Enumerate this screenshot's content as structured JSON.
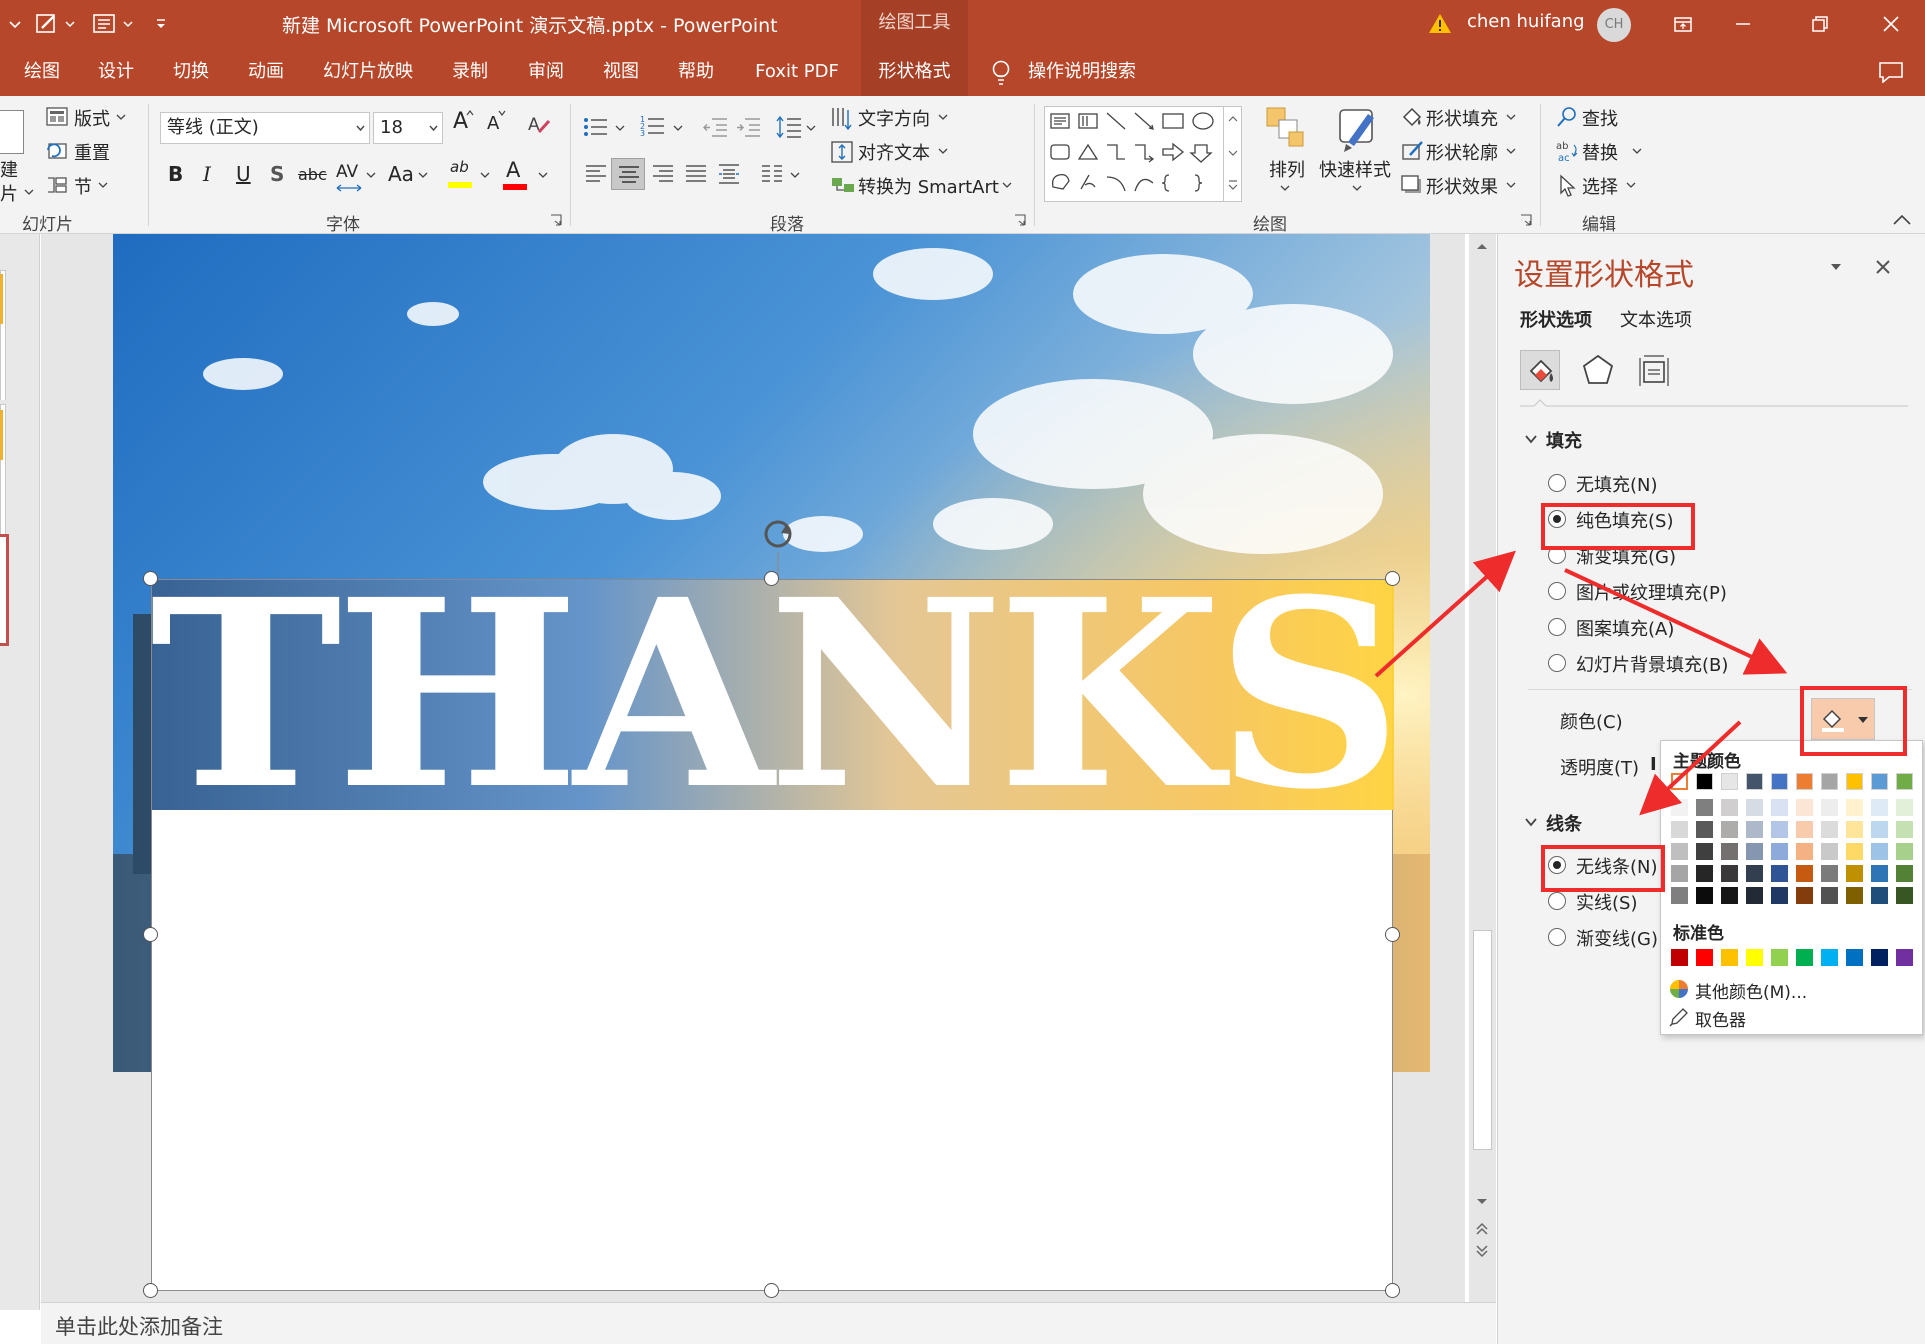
{
  "titlebar": {
    "title": "新建 Microsoft PowerPoint 演示文稿.pptx  -  PowerPoint",
    "context_tab": "绘图工具",
    "user": "chen huifang",
    "avatar_initials": "CH"
  },
  "tabs": [
    {
      "label": "绘图"
    },
    {
      "label": "设计"
    },
    {
      "label": "切换"
    },
    {
      "label": "动画"
    },
    {
      "label": "幻灯片放映"
    },
    {
      "label": "录制"
    },
    {
      "label": "审阅"
    },
    {
      "label": "视图"
    },
    {
      "label": "帮助"
    },
    {
      "label": "Foxit PDF"
    },
    {
      "label": "形状格式"
    }
  ],
  "tell_me": "操作说明搜索",
  "ribbon": {
    "slides": {
      "new_slide_partial_1": "建",
      "new_slide_partial_2": "片",
      "layout": "版式",
      "reset": "重置",
      "section": "节",
      "group_label": "幻灯片"
    },
    "font": {
      "font_name": "等线 (正文)",
      "font_size": "18",
      "grow": "A",
      "shrink": "A",
      "bold": "B",
      "italic": "I",
      "underline": "U",
      "shadow": "S",
      "strike": "abc",
      "spacing": "AV",
      "case": "Aa",
      "highlight": "ab",
      "font_color": "A",
      "group_label": "字体"
    },
    "paragraph": {
      "text_direction": "文字方向",
      "align_text": "对齐文本",
      "smartart": "转换为 SmartArt",
      "group_label": "段落"
    },
    "drawing": {
      "arrange": "排列",
      "quick_styles": "快速样式",
      "shape_fill": "形状填充",
      "shape_outline": "形状轮廓",
      "shape_effects": "形状效果",
      "group_label": "绘图"
    },
    "editing": {
      "find": "查找",
      "replace": "替换",
      "select": "选择",
      "group_label": "编辑"
    }
  },
  "slide": {
    "text": "THANKS"
  },
  "notes_placeholder": "单击此处添加备注",
  "pane": {
    "title": "设置形状格式",
    "tab_shape": "形状选项",
    "tab_text": "文本选项",
    "fill_section": "填充",
    "fill_options": [
      {
        "label": "无填充(N)",
        "selected": false
      },
      {
        "label": "纯色填充(S)",
        "selected": true
      },
      {
        "label": "渐变填充(G)",
        "selected": false
      },
      {
        "label": "图片或纹理填充(P)",
        "selected": false
      },
      {
        "label": "图案填充(A)",
        "selected": false
      },
      {
        "label": "幻灯片背景填充(B)",
        "selected": false
      }
    ],
    "color_label": "颜色(C)",
    "transparency_label": "透明度(T)",
    "transparency_partial": "I",
    "line_section": "线条",
    "line_options": [
      {
        "label": "无线条(N)",
        "selected": true
      },
      {
        "label": "实线(S)",
        "selected": false
      },
      {
        "label": "渐变线(G)",
        "selected": false
      }
    ]
  },
  "color_popup": {
    "theme_title": "主题颜色",
    "standard_title": "标准色",
    "more_colors": "其他颜色(M)...",
    "eyedropper": "取色器",
    "theme_top": [
      "#FFFFFF",
      "#000000",
      "#E7E6E6",
      "#44546A",
      "#4472C4",
      "#ED7D31",
      "#A5A5A5",
      "#FFC000",
      "#5B9BD5",
      "#70AD47"
    ],
    "theme_shades": [
      [
        "#F2F2F2",
        "#7F7F7F",
        "#D0CECE",
        "#D6DCE4",
        "#D9E2F3",
        "#FBE5D5",
        "#EDEDED",
        "#FFF2CC",
        "#DEEBF6",
        "#E2EFD9"
      ],
      [
        "#D8D8D8",
        "#595959",
        "#AEABAB",
        "#ADB9CA",
        "#B4C6E7",
        "#F7CBAC",
        "#DBDBDB",
        "#FEE599",
        "#BDD7EE",
        "#C5E0B3"
      ],
      [
        "#BFBFBF",
        "#3F3F3F",
        "#757070",
        "#8496B0",
        "#8EAADB",
        "#F4B183",
        "#C9C9C9",
        "#FFD965",
        "#9DC3E6",
        "#A8D08D"
      ],
      [
        "#A5A5A5",
        "#262626",
        "#3A3838",
        "#323F4F",
        "#2F5496",
        "#C55A11",
        "#7B7B7B",
        "#BF9000",
        "#2E75B5",
        "#538135"
      ],
      [
        "#7F7F7F",
        "#0C0C0C",
        "#171616",
        "#222A35",
        "#1F3864",
        "#833C0B",
        "#525252",
        "#7F6000",
        "#1E4E79",
        "#375623"
      ]
    ],
    "standard": [
      "#C00000",
      "#FF0000",
      "#FFC000",
      "#FFFF00",
      "#92D050",
      "#00B050",
      "#00B0F0",
      "#0070C0",
      "#002060",
      "#7030A0"
    ]
  },
  "colors": {
    "brand": "#B7472A",
    "annotation_red": "#EE2C2C"
  }
}
